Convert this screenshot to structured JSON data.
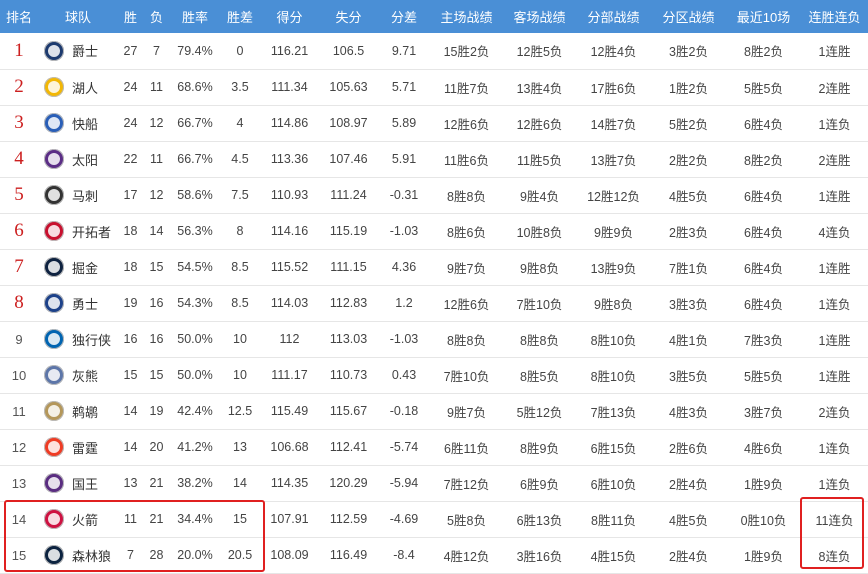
{
  "columns": [
    "排名",
    "球队",
    "胜",
    "负",
    "胜率",
    "胜差",
    "得分",
    "失分",
    "分差",
    "主场战绩",
    "客场战绩",
    "分部战绩",
    "分区战绩",
    "最近10场",
    "连胜连负"
  ],
  "colors": {
    "header_bg": "#4a8fd6",
    "top_rank": "#cc1f1f",
    "highlight": "#e02020"
  },
  "rows": [
    {
      "rank": "1",
      "team": "爵士",
      "w": "27",
      "l": "7",
      "pct": "79.4%",
      "gb": "0",
      "pts": "116.21",
      "opp": "106.5",
      "diff": "9.71",
      "home": "15胜2负",
      "away": "12胜5负",
      "div": "12胜4负",
      "conf": "3胜2负",
      "last10": "8胜2负",
      "streak": "1连胜",
      "logo_color": "#1d3a6e"
    },
    {
      "rank": "2",
      "team": "湖人",
      "w": "24",
      "l": "11",
      "pct": "68.6%",
      "gb": "3.5",
      "pts": "111.34",
      "opp": "105.63",
      "diff": "5.71",
      "home": "11胜7负",
      "away": "13胜4负",
      "div": "17胜6负",
      "conf": "1胜2负",
      "last10": "5胜5负",
      "streak": "2连胜",
      "logo_color": "#f2b705"
    },
    {
      "rank": "3",
      "team": "快船",
      "w": "24",
      "l": "12",
      "pct": "66.7%",
      "gb": "4",
      "pts": "114.86",
      "opp": "108.97",
      "diff": "5.89",
      "home": "12胜6负",
      "away": "12胜6负",
      "div": "14胜7负",
      "conf": "5胜2负",
      "last10": "6胜4负",
      "streak": "1连负",
      "logo_color": "#2a5fb8"
    },
    {
      "rank": "4",
      "team": "太阳",
      "w": "22",
      "l": "11",
      "pct": "66.7%",
      "gb": "4.5",
      "pts": "113.36",
      "opp": "107.46",
      "diff": "5.91",
      "home": "11胜6负",
      "away": "11胜5负",
      "div": "13胜7负",
      "conf": "2胜2负",
      "last10": "8胜2负",
      "streak": "2连胜",
      "logo_color": "#5b2d86"
    },
    {
      "rank": "5",
      "team": "马刺",
      "w": "17",
      "l": "12",
      "pct": "58.6%",
      "gb": "7.5",
      "pts": "110.93",
      "opp": "111.24",
      "diff": "-0.31",
      "home": "8胜8负",
      "away": "9胜4负",
      "div": "12胜12负",
      "conf": "4胜5负",
      "last10": "6胜4负",
      "streak": "1连胜",
      "logo_color": "#333333"
    },
    {
      "rank": "6",
      "team": "开拓者",
      "w": "18",
      "l": "14",
      "pct": "56.3%",
      "gb": "8",
      "pts": "114.16",
      "opp": "115.19",
      "diff": "-1.03",
      "home": "8胜6负",
      "away": "10胜8负",
      "div": "9胜9负",
      "conf": "2胜3负",
      "last10": "6胜4负",
      "streak": "4连负",
      "logo_color": "#c8102e"
    },
    {
      "rank": "7",
      "team": "掘金",
      "w": "18",
      "l": "15",
      "pct": "54.5%",
      "gb": "8.5",
      "pts": "115.52",
      "opp": "111.15",
      "diff": "4.36",
      "home": "9胜7负",
      "away": "9胜8负",
      "div": "13胜9负",
      "conf": "7胜1负",
      "last10": "6胜4负",
      "streak": "1连胜",
      "logo_color": "#0e2240"
    },
    {
      "rank": "8",
      "team": "勇士",
      "w": "19",
      "l": "16",
      "pct": "54.3%",
      "gb": "8.5",
      "pts": "114.03",
      "opp": "112.83",
      "diff": "1.2",
      "home": "12胜6负",
      "away": "7胜10负",
      "div": "9胜8负",
      "conf": "3胜3负",
      "last10": "6胜4负",
      "streak": "1连负",
      "logo_color": "#1d428a"
    },
    {
      "rank": "9",
      "team": "独行侠",
      "w": "16",
      "l": "16",
      "pct": "50.0%",
      "gb": "10",
      "pts": "112",
      "opp": "113.03",
      "diff": "-1.03",
      "home": "8胜8负",
      "away": "8胜8负",
      "div": "8胜10负",
      "conf": "4胜1负",
      "last10": "7胜3负",
      "streak": "1连胜",
      "logo_color": "#0064b1"
    },
    {
      "rank": "10",
      "team": "灰熊",
      "w": "15",
      "l": "15",
      "pct": "50.0%",
      "gb": "10",
      "pts": "111.17",
      "opp": "110.73",
      "diff": "0.43",
      "home": "7胜10负",
      "away": "8胜5负",
      "div": "8胜10负",
      "conf": "3胜5负",
      "last10": "5胜5负",
      "streak": "1连胜",
      "logo_color": "#5d76a9"
    },
    {
      "rank": "11",
      "team": "鹈鹕",
      "w": "14",
      "l": "19",
      "pct": "42.4%",
      "gb": "12.5",
      "pts": "115.49",
      "opp": "115.67",
      "diff": "-0.18",
      "home": "9胜7负",
      "away": "5胜12负",
      "div": "7胜13负",
      "conf": "4胜3负",
      "last10": "3胜7负",
      "streak": "2连负",
      "logo_color": "#b4975a"
    },
    {
      "rank": "12",
      "team": "雷霆",
      "w": "14",
      "l": "20",
      "pct": "41.2%",
      "gb": "13",
      "pts": "106.68",
      "opp": "112.41",
      "diff": "-5.74",
      "home": "6胜11负",
      "away": "8胜9负",
      "div": "6胜15负",
      "conf": "2胜6负",
      "last10": "4胜6负",
      "streak": "1连负",
      "logo_color": "#ef3b24"
    },
    {
      "rank": "13",
      "team": "国王",
      "w": "13",
      "l": "21",
      "pct": "38.2%",
      "gb": "14",
      "pts": "114.35",
      "opp": "120.29",
      "diff": "-5.94",
      "home": "7胜12负",
      "away": "6胜9负",
      "div": "6胜10负",
      "conf": "2胜4负",
      "last10": "1胜9负",
      "streak": "1连负",
      "logo_color": "#5a2d81"
    },
    {
      "rank": "14",
      "team": "火箭",
      "w": "11",
      "l": "21",
      "pct": "34.4%",
      "gb": "15",
      "pts": "107.91",
      "opp": "112.59",
      "diff": "-4.69",
      "home": "5胜8负",
      "away": "6胜13负",
      "div": "8胜11负",
      "conf": "4胜5负",
      "last10": "0胜10负",
      "streak": "11连负",
      "logo_color": "#ce1141"
    },
    {
      "rank": "15",
      "team": "森林狼",
      "w": "7",
      "l": "28",
      "pct": "20.0%",
      "gb": "20.5",
      "pts": "108.09",
      "opp": "116.49",
      "diff": "-8.4",
      "home": "4胜12负",
      "away": "3胜16负",
      "div": "4胜15负",
      "conf": "2胜4负",
      "last10": "1胜9负",
      "streak": "8连负",
      "logo_color": "#0c2340"
    }
  ]
}
